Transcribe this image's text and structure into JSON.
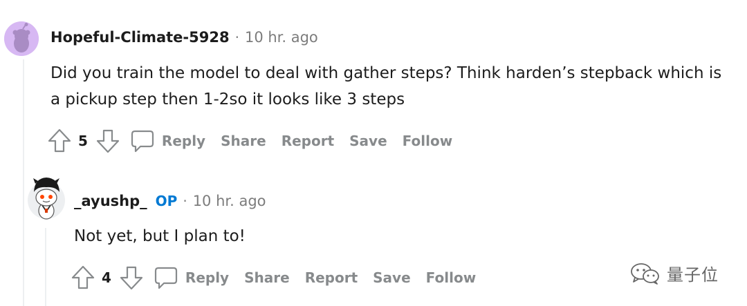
{
  "comments": [
    {
      "username": "Hopeful-Climate-5928",
      "separator": "·",
      "timestamp": "10 hr. ago",
      "body_lines": [
        "Did you train the model to deal with gather steps? Think harden’s stepback which is",
        "a pickup step then 1-2so it looks like 3 steps"
      ],
      "votes": "5",
      "actions": {
        "reply": "Reply",
        "share": "Share",
        "report": "Report",
        "save": "Save",
        "follow": "Follow"
      }
    },
    {
      "username": "_ayushp_",
      "badge": "OP",
      "separator": "·",
      "timestamp": "10 hr. ago",
      "body_lines": [
        "Not yet, but I plan to!"
      ],
      "votes": "4",
      "actions": {
        "reply": "Reply",
        "share": "Share",
        "report": "Report",
        "save": "Save",
        "follow": "Follow"
      }
    }
  ],
  "watermark": {
    "text": "量子位",
    "icon": "wechat-icon"
  },
  "colors": {
    "text": "#1c1c1c",
    "muted": "#878a8c",
    "timestamp": "#7c7c7c",
    "op_badge": "#0079d3",
    "thread_line": "#edeff1",
    "avatar1_bg": "#d7b8f3"
  }
}
